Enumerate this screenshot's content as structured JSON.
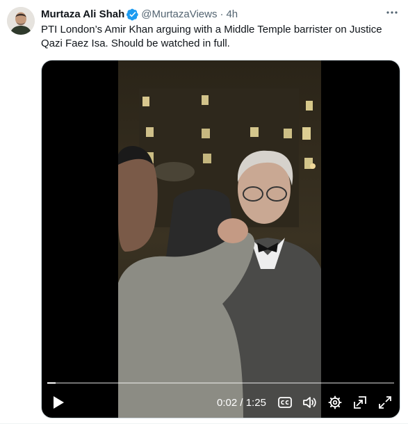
{
  "tweet": {
    "author_name": "Murtaza Ali Shah",
    "author_handle": "@MurtazaViews",
    "separator": "·",
    "time": "4h",
    "more_icon": "more-dots-icon",
    "verified_icon": "verified-badge-icon",
    "text": "PTI London’s Amir Khan arguing with a Middle Temple barrister on Justice Qazi Faez Isa. Should be watched in full."
  },
  "video": {
    "current_time": "0:02",
    "duration": "1:25",
    "time_separator": " / ",
    "progress_fraction": 0.024,
    "controls": [
      "play-icon",
      "captions-icon",
      "volume-icon",
      "settings-icon",
      "picture-in-picture-icon",
      "fullscreen-icon"
    ]
  },
  "colors": {
    "verified_blue": "#1d9bf0",
    "secondary_text": "#536471",
    "primary_text": "#0f1419",
    "video_background": "#000000"
  }
}
